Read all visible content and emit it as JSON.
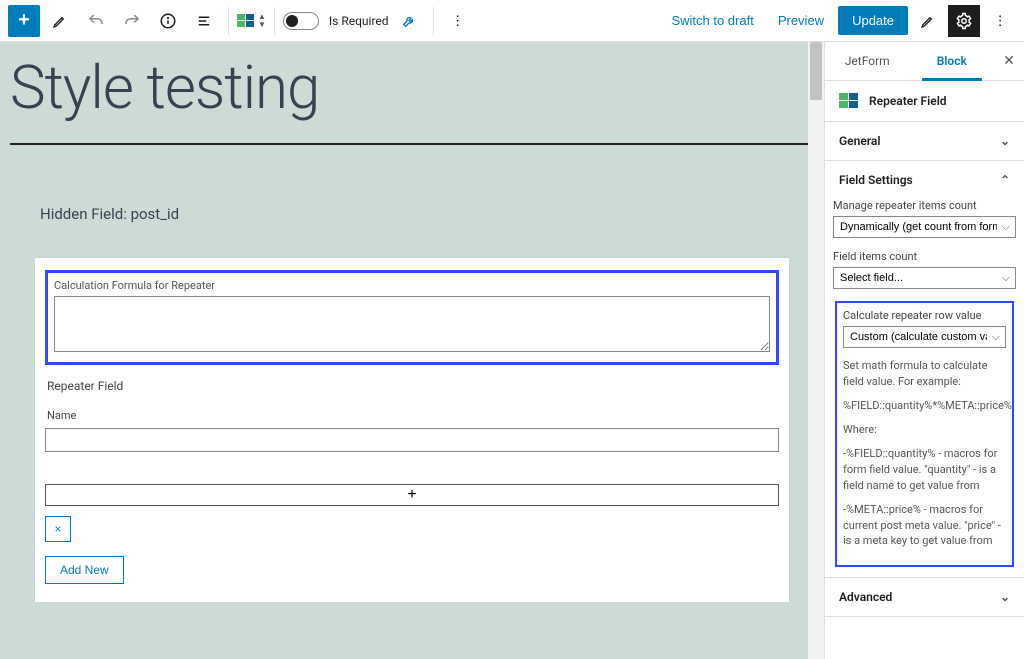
{
  "toolbar": {
    "is_required_label": "Is Required",
    "switch_draft": "Switch to draft",
    "preview": "Preview",
    "update": "Update"
  },
  "canvas": {
    "title": "Style testing",
    "hidden_field": "Hidden Field: post_id",
    "calc_label": "Calculation Formula for Repeater",
    "repeater_label": "Repeater Field",
    "name_label": "Name",
    "plus": "+",
    "remove": "×",
    "add_new": "Add New"
  },
  "sidebar": {
    "tabs": {
      "jetform": "JetForm",
      "block": "Block"
    },
    "block_type": "Repeater Field",
    "panels": {
      "general": "General",
      "field_settings": "Field Settings",
      "advanced": "Advanced"
    },
    "field_settings": {
      "manage_label": "Manage repeater items count",
      "manage_value": "Dynamically (get count from form field)",
      "count_label": "Field items count",
      "count_value": "Select field...",
      "calc_label": "Calculate repeater row value",
      "calc_value": "Custom (calculate custom value for each",
      "help_intro": "Set math formula to calculate field value. For example:",
      "help_formula": "%FIELD::quantity%*%META::price%",
      "help_where": "Where:",
      "help_field": "-%FIELD::quantity% - macros for form field value. \"quantity\" - is a field name to get value from",
      "help_meta": "-%META::price% - macros for current post meta value. \"price\" - is a meta key to get value from"
    }
  }
}
